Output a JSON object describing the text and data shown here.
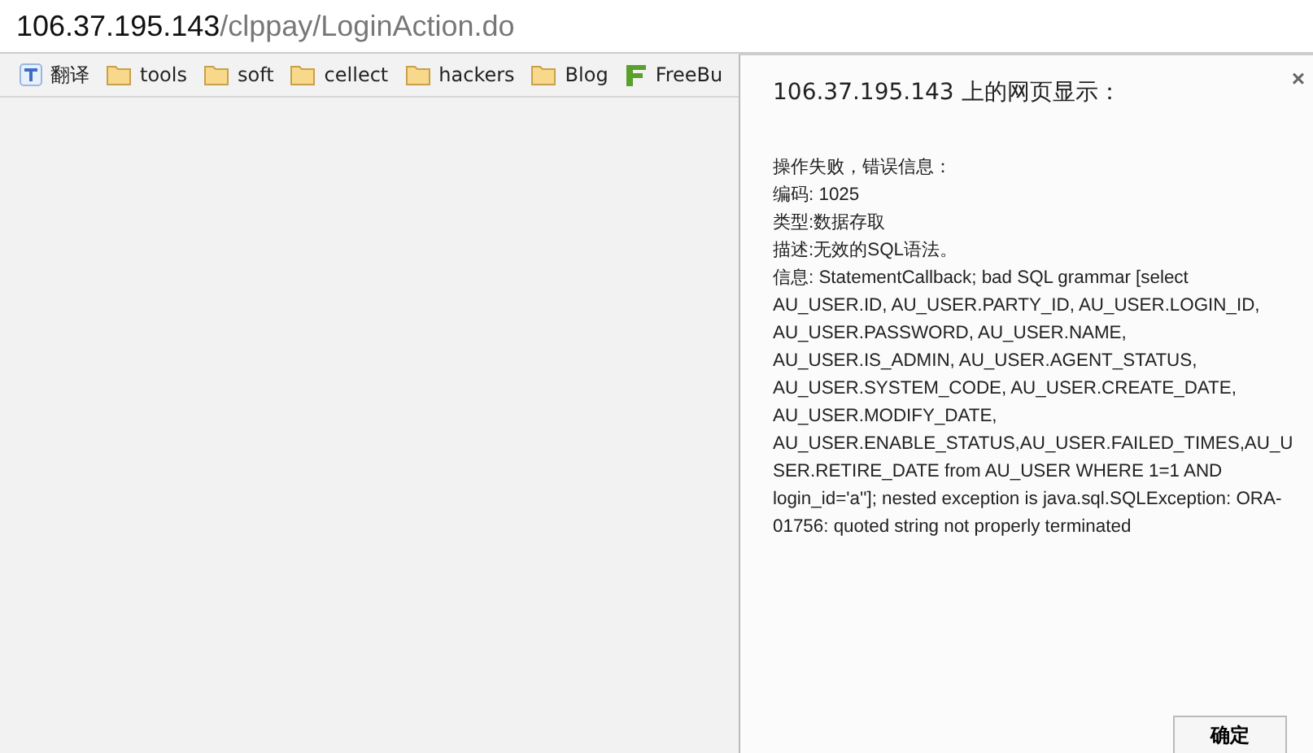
{
  "address_bar": {
    "host": "106.37.195.143",
    "path": "/clppay/LoginAction.do"
  },
  "bookmarks": [
    {
      "kind": "translate",
      "label": "翻译"
    },
    {
      "kind": "folder",
      "label": "tools"
    },
    {
      "kind": "folder",
      "label": "soft"
    },
    {
      "kind": "folder",
      "label": "cellect"
    },
    {
      "kind": "folder",
      "label": "hackers"
    },
    {
      "kind": "folder",
      "label": "Blog"
    },
    {
      "kind": "site",
      "label": "FreeBu"
    }
  ],
  "dialog": {
    "title": "106.37.195.143 上的网页显示：",
    "close": "×",
    "message_lines": [
      "操作失败，错误信息：",
      "编码: 1025",
      "类型:数据存取",
      "描述:无效的SQL语法。",
      "信息: StatementCallback; bad SQL grammar [select AU_USER.ID, AU_USER.PARTY_ID, AU_USER.LOGIN_ID, AU_USER.PASSWORD, AU_USER.NAME, AU_USER.IS_ADMIN, AU_USER.AGENT_STATUS, AU_USER.SYSTEM_CODE, AU_USER.CREATE_DATE, AU_USER.MODIFY_DATE, AU_USER.ENABLE_STATUS,AU_USER.FAILED_TIMES,AU_USER.RETIRE_DATE from AU_USER WHERE 1=1  AND login_id='a'']; nested exception is java.sql.SQLException: ORA-01756: quoted string not properly terminated"
    ],
    "ok_button": "确定"
  }
}
